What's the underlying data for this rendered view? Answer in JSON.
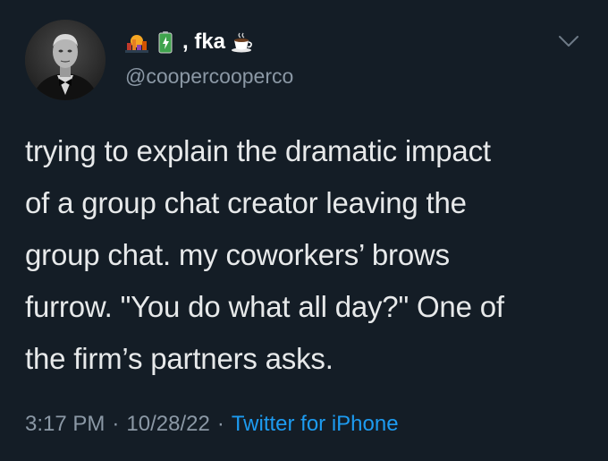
{
  "user": {
    "display_name_suffix": ", fka",
    "handle": "@coopercooperco",
    "name_icons": [
      "sunset-city-icon",
      "battery-icon",
      "coffee-icon"
    ]
  },
  "tweet": {
    "text": "trying to explain the dramatic impact\nof a group chat creator leaving the\ngroup chat. my coworkers’ brows\nfurrow. \"You do what all day?\" One of\nthe firm’s partners asks."
  },
  "meta": {
    "time": "3:17 PM",
    "separator": "·",
    "date": "10/28/22",
    "source": "Twitter for iPhone"
  },
  "colors": {
    "background": "#141d26",
    "text": "#e7e9ea",
    "muted": "#8b98a5",
    "link": "#1d9bf0"
  }
}
